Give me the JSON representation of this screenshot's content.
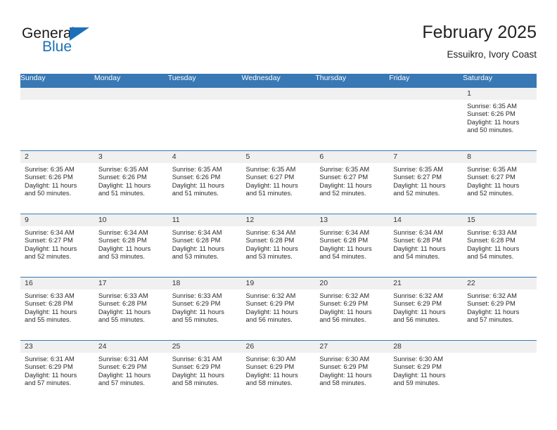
{
  "brand": {
    "name_part1": "General",
    "name_part2": "Blue",
    "triangle_color": "#1d70b8",
    "blue_color": "#1d70b8"
  },
  "header": {
    "title": "February 2025",
    "subtitle": "Essuikro, Ivory Coast"
  },
  "theme": {
    "header_bg": "#3878b4",
    "daynum_bg": "#f0f0f0",
    "border": "#3878b4"
  },
  "weekday_headers": [
    "Sunday",
    "Monday",
    "Tuesday",
    "Wednesday",
    "Thursday",
    "Friday",
    "Saturday"
  ],
  "labels": {
    "sunrise": "Sunrise:",
    "sunset": "Sunset:",
    "daylight": "Daylight:"
  },
  "weeks": [
    [
      {
        "day": "",
        "sunrise": "",
        "sunset": "",
        "daylight": "",
        "empty": true
      },
      {
        "day": "",
        "sunrise": "",
        "sunset": "",
        "daylight": "",
        "empty": true
      },
      {
        "day": "",
        "sunrise": "",
        "sunset": "",
        "daylight": "",
        "empty": true
      },
      {
        "day": "",
        "sunrise": "",
        "sunset": "",
        "daylight": "",
        "empty": true
      },
      {
        "day": "",
        "sunrise": "",
        "sunset": "",
        "daylight": "",
        "empty": true
      },
      {
        "day": "",
        "sunrise": "",
        "sunset": "",
        "daylight": "",
        "empty": true
      },
      {
        "day": "1",
        "sunrise": "Sunrise: 6:35 AM",
        "sunset": "Sunset: 6:26 PM",
        "daylight": "Daylight: 11 hours and 50 minutes.",
        "empty": false
      }
    ],
    [
      {
        "day": "2",
        "sunrise": "Sunrise: 6:35 AM",
        "sunset": "Sunset: 6:26 PM",
        "daylight": "Daylight: 11 hours and 50 minutes.",
        "empty": false
      },
      {
        "day": "3",
        "sunrise": "Sunrise: 6:35 AM",
        "sunset": "Sunset: 6:26 PM",
        "daylight": "Daylight: 11 hours and 51 minutes.",
        "empty": false
      },
      {
        "day": "4",
        "sunrise": "Sunrise: 6:35 AM",
        "sunset": "Sunset: 6:26 PM",
        "daylight": "Daylight: 11 hours and 51 minutes.",
        "empty": false
      },
      {
        "day": "5",
        "sunrise": "Sunrise: 6:35 AM",
        "sunset": "Sunset: 6:27 PM",
        "daylight": "Daylight: 11 hours and 51 minutes.",
        "empty": false
      },
      {
        "day": "6",
        "sunrise": "Sunrise: 6:35 AM",
        "sunset": "Sunset: 6:27 PM",
        "daylight": "Daylight: 11 hours and 52 minutes.",
        "empty": false
      },
      {
        "day": "7",
        "sunrise": "Sunrise: 6:35 AM",
        "sunset": "Sunset: 6:27 PM",
        "daylight": "Daylight: 11 hours and 52 minutes.",
        "empty": false
      },
      {
        "day": "8",
        "sunrise": "Sunrise: 6:35 AM",
        "sunset": "Sunset: 6:27 PM",
        "daylight": "Daylight: 11 hours and 52 minutes.",
        "empty": false
      }
    ],
    [
      {
        "day": "9",
        "sunrise": "Sunrise: 6:34 AM",
        "sunset": "Sunset: 6:27 PM",
        "daylight": "Daylight: 11 hours and 52 minutes.",
        "empty": false
      },
      {
        "day": "10",
        "sunrise": "Sunrise: 6:34 AM",
        "sunset": "Sunset: 6:28 PM",
        "daylight": "Daylight: 11 hours and 53 minutes.",
        "empty": false
      },
      {
        "day": "11",
        "sunrise": "Sunrise: 6:34 AM",
        "sunset": "Sunset: 6:28 PM",
        "daylight": "Daylight: 11 hours and 53 minutes.",
        "empty": false
      },
      {
        "day": "12",
        "sunrise": "Sunrise: 6:34 AM",
        "sunset": "Sunset: 6:28 PM",
        "daylight": "Daylight: 11 hours and 53 minutes.",
        "empty": false
      },
      {
        "day": "13",
        "sunrise": "Sunrise: 6:34 AM",
        "sunset": "Sunset: 6:28 PM",
        "daylight": "Daylight: 11 hours and 54 minutes.",
        "empty": false
      },
      {
        "day": "14",
        "sunrise": "Sunrise: 6:34 AM",
        "sunset": "Sunset: 6:28 PM",
        "daylight": "Daylight: 11 hours and 54 minutes.",
        "empty": false
      },
      {
        "day": "15",
        "sunrise": "Sunrise: 6:33 AM",
        "sunset": "Sunset: 6:28 PM",
        "daylight": "Daylight: 11 hours and 54 minutes.",
        "empty": false
      }
    ],
    [
      {
        "day": "16",
        "sunrise": "Sunrise: 6:33 AM",
        "sunset": "Sunset: 6:28 PM",
        "daylight": "Daylight: 11 hours and 55 minutes.",
        "empty": false
      },
      {
        "day": "17",
        "sunrise": "Sunrise: 6:33 AM",
        "sunset": "Sunset: 6:28 PM",
        "daylight": "Daylight: 11 hours and 55 minutes.",
        "empty": false
      },
      {
        "day": "18",
        "sunrise": "Sunrise: 6:33 AM",
        "sunset": "Sunset: 6:29 PM",
        "daylight": "Daylight: 11 hours and 55 minutes.",
        "empty": false
      },
      {
        "day": "19",
        "sunrise": "Sunrise: 6:32 AM",
        "sunset": "Sunset: 6:29 PM",
        "daylight": "Daylight: 11 hours and 56 minutes.",
        "empty": false
      },
      {
        "day": "20",
        "sunrise": "Sunrise: 6:32 AM",
        "sunset": "Sunset: 6:29 PM",
        "daylight": "Daylight: 11 hours and 56 minutes.",
        "empty": false
      },
      {
        "day": "21",
        "sunrise": "Sunrise: 6:32 AM",
        "sunset": "Sunset: 6:29 PM",
        "daylight": "Daylight: 11 hours and 56 minutes.",
        "empty": false
      },
      {
        "day": "22",
        "sunrise": "Sunrise: 6:32 AM",
        "sunset": "Sunset: 6:29 PM",
        "daylight": "Daylight: 11 hours and 57 minutes.",
        "empty": false
      }
    ],
    [
      {
        "day": "23",
        "sunrise": "Sunrise: 6:31 AM",
        "sunset": "Sunset: 6:29 PM",
        "daylight": "Daylight: 11 hours and 57 minutes.",
        "empty": false
      },
      {
        "day": "24",
        "sunrise": "Sunrise: 6:31 AM",
        "sunset": "Sunset: 6:29 PM",
        "daylight": "Daylight: 11 hours and 57 minutes.",
        "empty": false
      },
      {
        "day": "25",
        "sunrise": "Sunrise: 6:31 AM",
        "sunset": "Sunset: 6:29 PM",
        "daylight": "Daylight: 11 hours and 58 minutes.",
        "empty": false
      },
      {
        "day": "26",
        "sunrise": "Sunrise: 6:30 AM",
        "sunset": "Sunset: 6:29 PM",
        "daylight": "Daylight: 11 hours and 58 minutes.",
        "empty": false
      },
      {
        "day": "27",
        "sunrise": "Sunrise: 6:30 AM",
        "sunset": "Sunset: 6:29 PM",
        "daylight": "Daylight: 11 hours and 58 minutes.",
        "empty": false
      },
      {
        "day": "28",
        "sunrise": "Sunrise: 6:30 AM",
        "sunset": "Sunset: 6:29 PM",
        "daylight": "Daylight: 11 hours and 59 minutes.",
        "empty": false
      },
      {
        "day": "",
        "sunrise": "",
        "sunset": "",
        "daylight": "",
        "empty": true
      }
    ]
  ]
}
